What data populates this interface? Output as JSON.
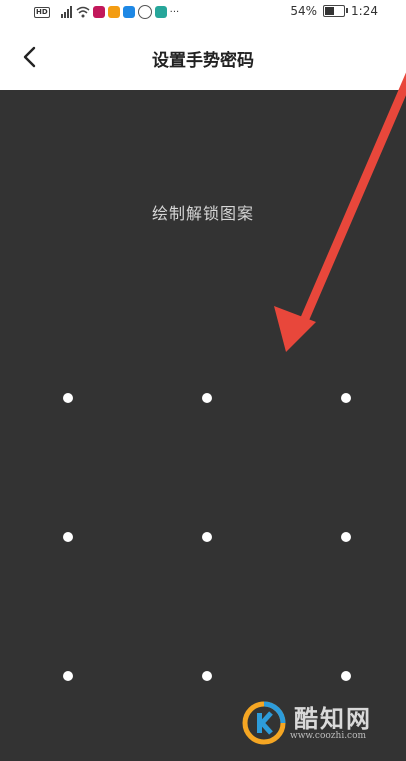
{
  "status_bar": {
    "network": "HD",
    "signal_label": "4G",
    "battery_percent": "54%",
    "battery_level": 0.54,
    "time": "1:24",
    "more_indicator": "···"
  },
  "header": {
    "back_icon": "chevron-left-icon",
    "title": "设置手势密码"
  },
  "gesture": {
    "prompt": "绘制解锁图案",
    "grid_rows": 3,
    "grid_cols": 3
  },
  "annotation": {
    "arrow_color": "#e8473b"
  },
  "watermark": {
    "name": "酷知网",
    "url": "www.coozhi.com"
  },
  "colors": {
    "background": "#333333",
    "dot": "#ffffff",
    "header_bg": "#ffffff"
  }
}
